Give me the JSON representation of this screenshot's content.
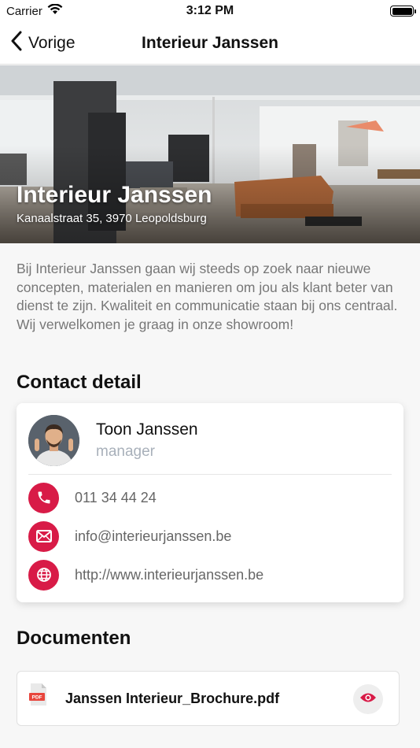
{
  "status_bar": {
    "carrier": "Carrier",
    "time": "3:12 PM",
    "battery_level": 1.0
  },
  "nav": {
    "back_label": "Vorige",
    "title": "Interieur Janssen"
  },
  "hero": {
    "name": "Interieur Janssen",
    "address": "Kanaalstraat 35, 3970 Leopoldsburg"
  },
  "description": "Bij Interieur Janssen gaan wij steeds op zoek naar nieuwe concepten, materialen en manieren om jou als klant beter van dienst te zijn. Kwaliteit en communicatie staan bij ons centraal. Wij verwelkomen je graag in onze showroom!",
  "contact": {
    "section_title": "Contact detail",
    "name": "Toon Janssen",
    "role": "manager",
    "phone": "011 34 44 24",
    "email": "info@interieurjanssen.be",
    "website": "http://www.interieurjanssen.be",
    "icons": [
      "phone-icon",
      "mail-icon",
      "globe-icon"
    ]
  },
  "documents": {
    "section_title": "Documenten",
    "items": [
      {
        "name": "Janssen Interieur_Brochure.pdf",
        "file_badge": "PDF"
      }
    ]
  },
  "colors": {
    "accent": "#d81b47",
    "muted_text": "#777777",
    "role_text": "#a8b0ba"
  }
}
